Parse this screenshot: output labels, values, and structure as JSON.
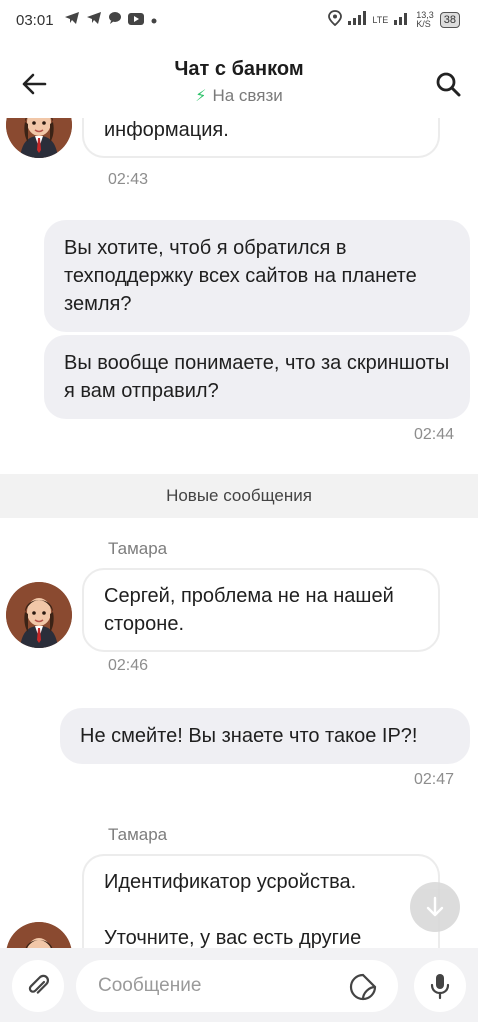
{
  "status_bar": {
    "time": "03:01",
    "left_icons": [
      "telegram-icon",
      "telegram-icon",
      "chat-icon",
      "youtube-icon",
      "dot-icon"
    ],
    "network_label": "LTE",
    "speed_value": "13,3",
    "speed_unit": "K/S",
    "battery": "38"
  },
  "header": {
    "title": "Чат с банком",
    "status": "На связи",
    "status_color": "#2ec26a"
  },
  "messages": {
    "m1_text": "информация.",
    "m1_time": "02:43",
    "m2_text": "Вы хотите, чтоб я обратился в техподдержку всех сайтов на планете земля?",
    "m3_text": "Вы вообще понимаете, что за скриншоты я вам отправил?",
    "m3_time": "02:44",
    "divider": "Новые сообщения",
    "m4_sender": "Тамара",
    "m4_text": "Сергей, проблема не на нашей стороне.",
    "m4_time": "02:46",
    "m5_text": "Не смейте! Вы знаете что такое IP?!",
    "m5_time": "02:47",
    "m6_sender": "Тамара",
    "m6_line1": "Идентификатор усройства.",
    "m6_line2": "Уточните, у вас есть другие"
  },
  "input": {
    "placeholder": "Сообщение"
  }
}
